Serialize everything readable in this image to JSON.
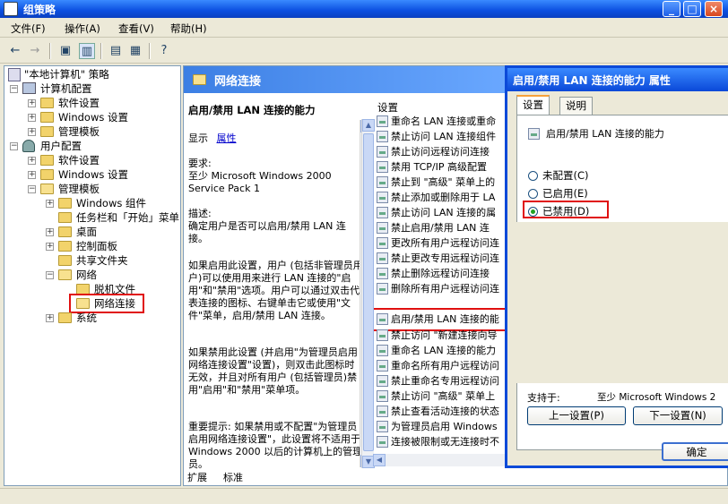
{
  "window": {
    "title": "组策略",
    "min": "_",
    "max": "□",
    "close": "×"
  },
  "menu": [
    "文件(F)",
    "操作(A)",
    "查看(V)",
    "帮助(H)"
  ],
  "tree": {
    "root": "\"本地计算机\" 策略",
    "computer": "计算机配置",
    "c_software": "软件设置",
    "c_windows": "Windows 设置",
    "c_templates": "管理模板",
    "user": "用户配置",
    "u_software": "软件设置",
    "u_windows": "Windows 设置",
    "u_templates": "管理模板",
    "win_components": "Windows 组件",
    "taskbar": "任务栏和「开始」菜单",
    "desktop": "桌面",
    "control_panel": "控制面板",
    "shared_folders": "共享文件夹",
    "network": "网络",
    "offline_files": "脱机文件",
    "network_connections": "网络连接",
    "system": "系统"
  },
  "header": {
    "title": "网络连接"
  },
  "description": {
    "title": "启用/禁用 LAN 连接的能力",
    "show_label": "显示",
    "show_link": "属性",
    "requirements": "要求:\n至少 Microsoft Windows 2000 Service Pack 1",
    "desc_label": "描述:",
    "desc_text": "确定用户是否可以启用/禁用 LAN 连接。",
    "p1": "如果启用此设置，用户 (包括非管理员用户)可以使用用来进行 LAN 连接的\"启用\"和\"禁用\"选项。用户可以通过双击代表连接的图标、右键单击它或使用\"文件\"菜单，启用/禁用 LAN 连接。",
    "p2": "如果禁用此设置 (并启用\"为管理员启用网络连接设置\"设置)，则双击此图标时无效，并且对所有用户 (包括管理员)禁用\"启用\"和\"禁用\"菜单项。",
    "p3": "重要提示: 如果禁用或不配置\"为管理员启用网络连接设置\"，此设置将不适用于 Windows 2000 以后的计算机上的管理员。"
  },
  "list": {
    "header": "设置",
    "items": [
      "重命名 LAN 连接或重命",
      "禁止访问 LAN 连接组件",
      "禁止访问远程访问连接",
      "禁用 TCP/IP 高级配置",
      "禁止到 \"高级\" 菜单上的",
      "禁止添加或删除用于 LA",
      "禁止访问 LAN 连接的属",
      "禁止启用/禁用 LAN 连",
      "更改所有用户远程访问连",
      "禁止更改专用远程访问连",
      "禁止删除远程访问连接",
      "删除所有用户远程访问连",
      "启用/禁用 LAN 连接的能",
      "禁止访问 \"新建连接向导",
      "重命名 LAN 连接的能力",
      "重命名所有用户远程访问",
      "禁止重命名专用远程访问",
      "禁止访问 \"高级\" 菜单上",
      "禁止查看活动连接的状态",
      "为管理员启用 Windows",
      "连接被限制或无连接时不"
    ]
  },
  "tabs": {
    "extended": "扩展",
    "standard": "标准"
  },
  "dialog": {
    "title": "启用/禁用 LAN 连接的能力 属性",
    "tab_settings": "设置",
    "tab_explain": "说明",
    "setting_name": "启用/禁用 LAN 连接的能力",
    "options": [
      "未配置(C)",
      "已启用(E)",
      "已禁用(D)"
    ],
    "selected": "已禁用(D)",
    "supported_label": "支持于:",
    "supported_value": "至少 Microsoft Windows 2",
    "prev": "上一设置(P)",
    "next": "下一设置(N)",
    "ok": "确定"
  }
}
